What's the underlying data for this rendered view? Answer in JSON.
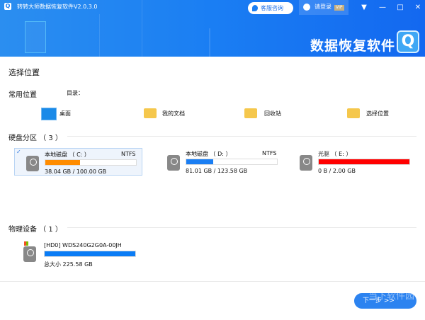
{
  "app": {
    "title": "转转大师数据恢复软件V2.0.3.0",
    "consult": "客服咨询",
    "login": "请登录",
    "vip": "VIP",
    "brand": "数据恢复软件"
  },
  "page": {
    "title": "选择位置",
    "common": "常用位置",
    "dir_label": "目录：",
    "quick": [
      {
        "label": "桌面",
        "icon": "desktop-icon"
      },
      {
        "label": "我的文档",
        "icon": "documents-icon"
      },
      {
        "label": "回收站",
        "icon": "recycle-bin-icon"
      },
      {
        "label": "选择位置",
        "icon": "folder-search-icon"
      }
    ],
    "partitions_title": "硬盘分区 （ 3 ）",
    "partitions": [
      {
        "name": "本地磁盘 （ C: ）",
        "fs": "NTFS",
        "usage": "38.04 GB / 100.00 GB",
        "fill": 0.38,
        "color": "#ff8c00",
        "selected": true
      },
      {
        "name": "本地磁盘 （ D: ）",
        "fs": "NTFS",
        "usage": "81.01 GB / 123.58 GB",
        "fill": 0.3,
        "color": "#1a7ef3",
        "selected": false
      },
      {
        "name": "光驱 （ E: ）",
        "fs": "",
        "usage": "0 B / 2.00 GB",
        "fill": 1.0,
        "color": "#ff0000",
        "selected": false
      }
    ],
    "physical_title": "物理设备 （ 1 ）",
    "physical": [
      {
        "name": "[HD0] WDS240G2G0A-00JH",
        "total": "总大小 225.58 GB",
        "fill": 1.0,
        "color": "#0a7cf5"
      }
    ],
    "next": "下一步 >>",
    "watermark": "当下软件园"
  }
}
